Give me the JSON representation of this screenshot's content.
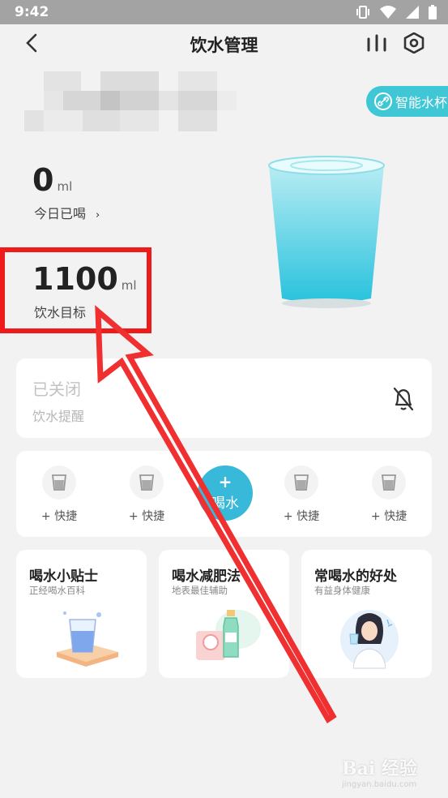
{
  "status_bar": {
    "time": "9:42"
  },
  "header": {
    "title": "饮水管理"
  },
  "smart_cup": {
    "label": "智能水杯"
  },
  "today": {
    "value": "0",
    "unit": "ml",
    "label": "今日已喝",
    "chevron": "›"
  },
  "goal": {
    "value": "1100",
    "unit": "ml",
    "label": "饮水目标",
    "chevron": "›"
  },
  "reminder": {
    "state": "已关闭",
    "label": "饮水提醒"
  },
  "quick": {
    "slots": [
      "+ 快捷",
      "+ 快捷",
      "+ 快捷",
      "+ 快捷"
    ],
    "drink_plus": "+",
    "drink_label": "喝水"
  },
  "tips": [
    {
      "title": "喝水小贴士",
      "subtitle": "正经喝水百科"
    },
    {
      "title": "喝水减肥法",
      "subtitle": "地表最佳辅助"
    },
    {
      "title": "常喝水的好处",
      "subtitle": "有益身体健康"
    }
  ],
  "watermark": {
    "brand": "Bai 经验",
    "url": "jingyan.baidu.com"
  },
  "colors": {
    "accent": "#38b9d9",
    "annotation": "#ef1a1a"
  }
}
